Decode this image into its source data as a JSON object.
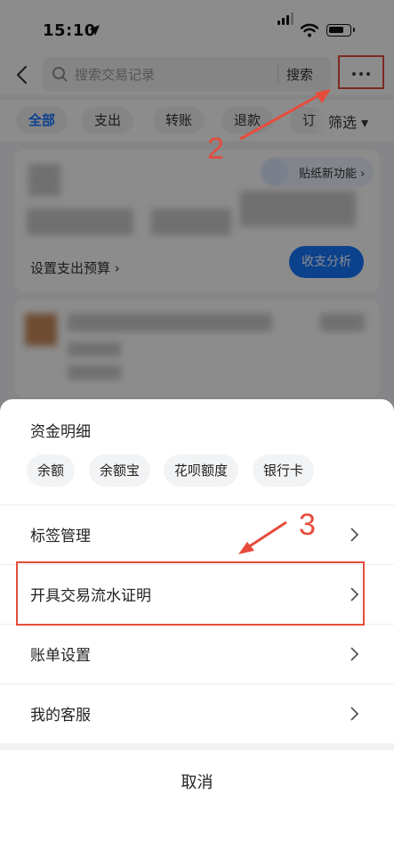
{
  "status_bar": {
    "time": "15:10"
  },
  "search": {
    "placeholder": "搜索交易记录",
    "button_label": "搜索"
  },
  "filters": {
    "chips": [
      "全部",
      "支出",
      "转账",
      "退款",
      "订"
    ],
    "filter_label": "筛选 ▾"
  },
  "summary": {
    "sticker_label": "贴纸新功能 ›",
    "budget_link": "设置支出预算 ›",
    "analysis_button": "收支分析"
  },
  "sheet": {
    "title": "资金明细",
    "fund_chips": [
      "余额",
      "余额宝",
      "花呗额度",
      "银行卡"
    ],
    "menu_items": [
      "标签管理",
      "开具交易流水证明",
      "账单设置",
      "我的客服"
    ],
    "cancel_label": "取消"
  },
  "annotations": {
    "step_2": "2",
    "step_3": "3"
  },
  "colors": {
    "accent": "#1677ff",
    "annotation": "#e64c3c"
  },
  "icons": [
    "location-arrow-icon",
    "signal-icon",
    "wifi-icon",
    "battery-icon",
    "back-icon",
    "search-icon",
    "more-icon",
    "chevron-right-icon"
  ]
}
